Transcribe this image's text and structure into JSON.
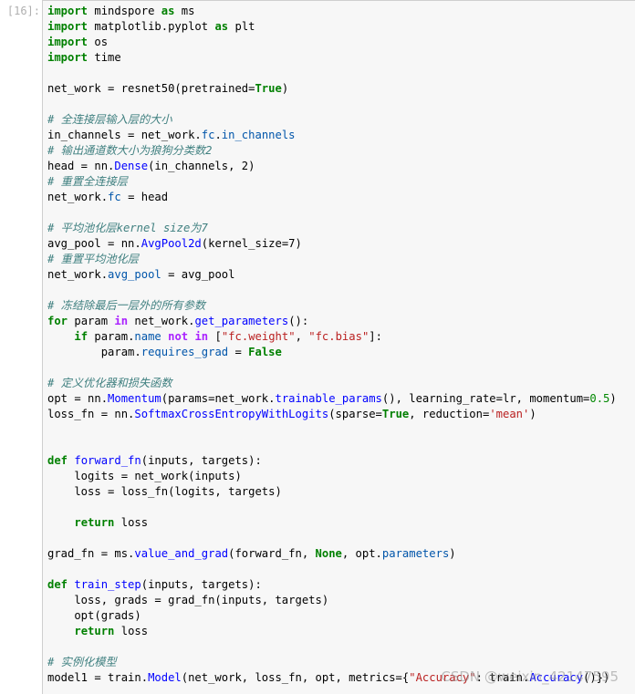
{
  "cell": {
    "prompt": "[16]:",
    "watermark": "CSDN @weixin_42147595"
  },
  "colors": {
    "keyword": "#008000",
    "operator_word": "#aa22ff",
    "comment": "#408080",
    "function": "#0000ff",
    "string": "#ba2121",
    "number": "#008800",
    "cell_background": "#f7f7f7",
    "cell_border": "#cfcfcf"
  },
  "code_lines": [
    [
      [
        "kw",
        "import"
      ],
      [
        "pl",
        " mindspore "
      ],
      [
        "kw",
        "as"
      ],
      [
        "pl",
        " ms"
      ]
    ],
    [
      [
        "kw",
        "import"
      ],
      [
        "pl",
        " matplotlib.pyplot "
      ],
      [
        "kw",
        "as"
      ],
      [
        "pl",
        " plt"
      ]
    ],
    [
      [
        "kw",
        "import"
      ],
      [
        "pl",
        " os"
      ]
    ],
    [
      [
        "kw",
        "import"
      ],
      [
        "pl",
        " time"
      ]
    ],
    [],
    [
      [
        "pl",
        "net_work = resnet50(pretrained="
      ],
      [
        "kw",
        "True"
      ],
      [
        "pl",
        ")"
      ]
    ],
    [],
    [
      [
        "cm",
        "# 全连接层输入层的大小"
      ]
    ],
    [
      [
        "pl",
        "in_channels = net_work."
      ],
      [
        "at",
        "fc"
      ],
      [
        "pl",
        "."
      ],
      [
        "at",
        "in_channels"
      ]
    ],
    [
      [
        "cm",
        "# 输出通道数大小为狼狗分类数2"
      ]
    ],
    [
      [
        "pl",
        "head = nn."
      ],
      [
        "fn",
        "Dense"
      ],
      [
        "pl",
        "(in_channels, 2)"
      ]
    ],
    [
      [
        "cm",
        "# 重置全连接层"
      ]
    ],
    [
      [
        "pl",
        "net_work."
      ],
      [
        "at",
        "fc"
      ],
      [
        "pl",
        " = head"
      ]
    ],
    [],
    [
      [
        "cm",
        "# 平均池化层kernel size为7"
      ]
    ],
    [
      [
        "pl",
        "avg_pool = nn."
      ],
      [
        "fn",
        "AvgPool2d"
      ],
      [
        "pl",
        "(kernel_size=7)"
      ]
    ],
    [
      [
        "cm",
        "# 重置平均池化层"
      ]
    ],
    [
      [
        "pl",
        "net_work."
      ],
      [
        "at",
        "avg_pool"
      ],
      [
        "pl",
        " = avg_pool"
      ]
    ],
    [],
    [
      [
        "cm",
        "# 冻结除最后一层外的所有参数"
      ]
    ],
    [
      [
        "kw",
        "for"
      ],
      [
        "pl",
        " param "
      ],
      [
        "op",
        "in"
      ],
      [
        "pl",
        " net_work."
      ],
      [
        "fn",
        "get_parameters"
      ],
      [
        "pl",
        "():"
      ]
    ],
    [
      [
        "pl",
        "    "
      ],
      [
        "kw",
        "if"
      ],
      [
        "pl",
        " param."
      ],
      [
        "at",
        "name"
      ],
      [
        "pl",
        " "
      ],
      [
        "op",
        "not in"
      ],
      [
        "pl",
        " ["
      ],
      [
        "st",
        "\"fc.weight\""
      ],
      [
        "pl",
        ", "
      ],
      [
        "st",
        "\"fc.bias\""
      ],
      [
        "pl",
        "]:"
      ]
    ],
    [
      [
        "pl",
        "        param."
      ],
      [
        "at",
        "requires_grad"
      ],
      [
        "pl",
        " = "
      ],
      [
        "kw",
        "False"
      ]
    ],
    [],
    [
      [
        "cm",
        "# 定义优化器和损失函数"
      ]
    ],
    [
      [
        "pl",
        "opt = nn."
      ],
      [
        "fn",
        "Momentum"
      ],
      [
        "pl",
        "(params=net_work."
      ],
      [
        "fn",
        "trainable_params"
      ],
      [
        "pl",
        "(), learning_rate=lr, momentum="
      ],
      [
        "nm",
        "0.5"
      ],
      [
        "pl",
        ")"
      ]
    ],
    [
      [
        "pl",
        "loss_fn = nn."
      ],
      [
        "fn",
        "SoftmaxCrossEntropyWithLogits"
      ],
      [
        "pl",
        "(sparse="
      ],
      [
        "kw",
        "True"
      ],
      [
        "pl",
        ", reduction="
      ],
      [
        "st",
        "'mean'"
      ],
      [
        "pl",
        ")"
      ]
    ],
    [],
    [],
    [
      [
        "kw",
        "def"
      ],
      [
        "pl",
        " "
      ],
      [
        "fn",
        "forward_fn"
      ],
      [
        "pl",
        "(inputs, targets):"
      ]
    ],
    [
      [
        "pl",
        "    logits = net_work(inputs)"
      ]
    ],
    [
      [
        "pl",
        "    loss = loss_fn(logits, targets)"
      ]
    ],
    [],
    [
      [
        "pl",
        "    "
      ],
      [
        "kw",
        "return"
      ],
      [
        "pl",
        " loss"
      ]
    ],
    [],
    [
      [
        "pl",
        "grad_fn = ms."
      ],
      [
        "fn",
        "value_and_grad"
      ],
      [
        "pl",
        "(forward_fn, "
      ],
      [
        "kw",
        "None"
      ],
      [
        "pl",
        ", opt."
      ],
      [
        "at",
        "parameters"
      ],
      [
        "pl",
        ")"
      ]
    ],
    [],
    [
      [
        "kw",
        "def"
      ],
      [
        "pl",
        " "
      ],
      [
        "fn",
        "train_step"
      ],
      [
        "pl",
        "(inputs, targets):"
      ]
    ],
    [
      [
        "pl",
        "    loss, grads = grad_fn(inputs, targets)"
      ]
    ],
    [
      [
        "pl",
        "    opt(grads)"
      ]
    ],
    [
      [
        "pl",
        "    "
      ],
      [
        "kw",
        "return"
      ],
      [
        "pl",
        " loss"
      ]
    ],
    [],
    [
      [
        "cm",
        "# 实例化模型"
      ]
    ],
    [
      [
        "pl",
        "model1 = train."
      ],
      [
        "fn",
        "Model"
      ],
      [
        "pl",
        "(net_work, loss_fn, opt, metrics={"
      ],
      [
        "st",
        "\"Accuracy\""
      ],
      [
        "pl",
        ": train."
      ],
      [
        "fn",
        "Accuracy"
      ],
      [
        "pl",
        "()})"
      ]
    ]
  ]
}
